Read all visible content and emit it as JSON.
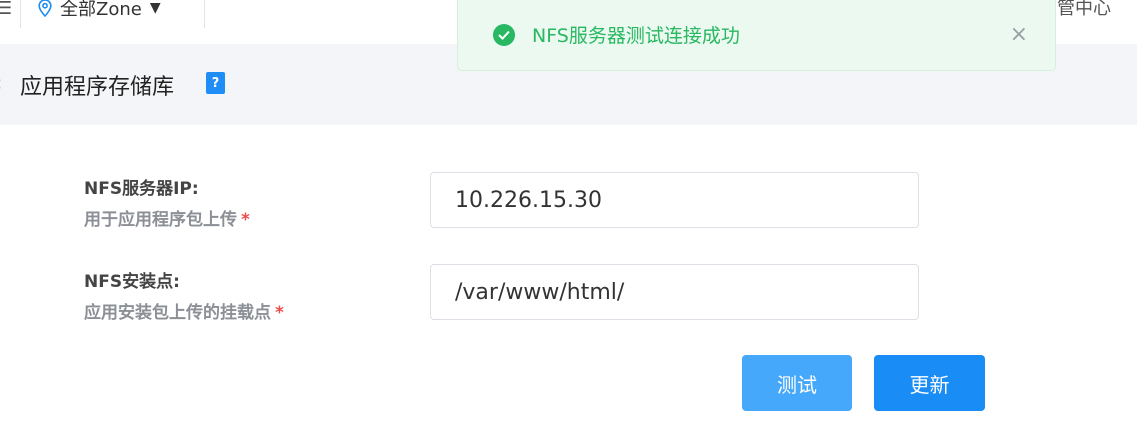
{
  "topbar": {
    "left_edge_glyph": "☰",
    "zone_label": "全部Zone",
    "right_text": "管中心"
  },
  "header": {
    "back_glyph": "‹",
    "title": "应用程序存储库",
    "help_glyph": "?"
  },
  "toast": {
    "message": "NFS服务器测试连接成功",
    "close_glyph": "×",
    "color": "#27b861"
  },
  "form": {
    "nfs_ip": {
      "label": "NFS服务器IP:",
      "sublabel": "用于应用程序包上传",
      "required_mark": "*",
      "value": "10.226.15.30"
    },
    "nfs_mount": {
      "label": "NFS安装点:",
      "sublabel": "应用安装包上传的挂载点",
      "required_mark": "*",
      "value": "/var/www/html/"
    },
    "buttons": {
      "test_label": "测试",
      "update_label": "更新"
    }
  },
  "colors": {
    "accent": "#1a8cf5",
    "accent_light": "#46a8fb",
    "required": "#f04b4b",
    "title_bar_bg": "#f4f5f8"
  }
}
